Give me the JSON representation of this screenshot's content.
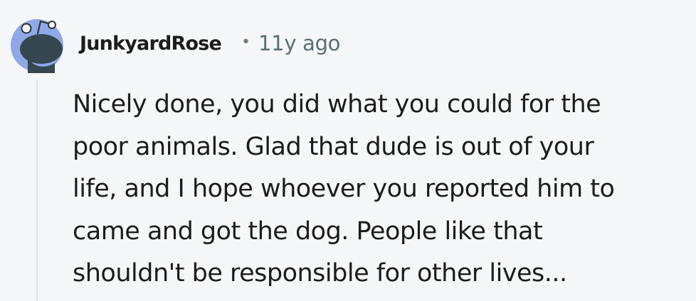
{
  "comment": {
    "author": "JunkyardRose",
    "separator": "•",
    "timestamp": "11y ago",
    "avatar_icon": "snoo-avatar-icon",
    "body_lines": [
      "Nicely done, you did what you could for the",
      "poor animals. Glad that dude is out of your",
      "life, and I hope whoever you reported him to",
      "came and got the dog. People like that",
      "shouldn't be responsible for other lives..."
    ]
  },
  "colors": {
    "background": "#f6f7f8",
    "avatar_bg": "#8fa8e8",
    "text": "#1c1c1c",
    "meta": "#576f76",
    "thread_line": "#e0e2e5"
  }
}
